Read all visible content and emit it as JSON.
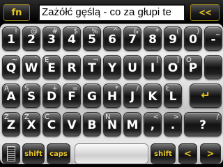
{
  "top_bar": {
    "fn_label": "fn",
    "text_value": "Zażółć gęślą - co za głupi te",
    "backspace_label": "<<"
  },
  "rows": [
    [
      {
        "main": "1",
        "alt": "!"
      },
      {
        "main": "2",
        "alt": "@"
      },
      {
        "main": "3",
        "alt": "#"
      },
      {
        "main": "4",
        "alt": "$"
      },
      {
        "main": "5",
        "alt": "%"
      },
      {
        "main": "6",
        "alt": "^"
      },
      {
        "main": "7",
        "alt": "&"
      },
      {
        "main": "8",
        "alt": "*"
      },
      {
        "main": "9",
        "alt": "("
      },
      {
        "main": "0",
        "alt": ")"
      },
      {
        "main": "-",
        "alt": "_"
      }
    ],
    [
      {
        "main": "Q",
        "alt": "~",
        "alt_left": ""
      },
      {
        "main": "W",
        "alt": "`",
        "alt_left": ""
      },
      {
        "main": "E",
        "alt": "",
        "alt_left": "Ę"
      },
      {
        "main": "R",
        "alt": "",
        "alt_left": ""
      },
      {
        "main": "T",
        "alt": "¬",
        "alt_left": ""
      },
      {
        "main": "Y",
        "alt": "",
        "alt_left": ""
      },
      {
        "main": "U",
        "alt": "",
        "alt_left": ""
      },
      {
        "main": "I",
        "alt": "[",
        "alt_left": ""
      },
      {
        "main": "O",
        "alt": "]",
        "alt_left": ""
      },
      {
        "main": "P",
        "alt": "",
        "alt_left": "Ó"
      },
      {
        "main": "",
        "alt": "",
        "alt_left": ""
      }
    ],
    [
      {
        "main": "A",
        "alt": "",
        "alt_left": "Ą"
      },
      {
        "main": "S",
        "alt": "",
        "alt_left": "Ś"
      },
      {
        "main": "D",
        "alt": "+",
        "alt_left": ""
      },
      {
        "main": "F",
        "alt": "=",
        "alt_left": ""
      },
      {
        "main": "G",
        "alt": "",
        "alt_left": ""
      },
      {
        "main": "H",
        "alt": "*",
        "alt_left": ""
      },
      {
        "main": "J",
        "alt": "/",
        "alt_left": ""
      },
      {
        "main": "K",
        "alt": "",
        "alt_left": ""
      },
      {
        "main": "L",
        "alt": "",
        "alt_left": "Ł"
      },
      {
        "main": "",
        "alt": "",
        "alt_left": ""
      }
    ],
    [
      {
        "main": "Z",
        "alt": "",
        "alt_left": "Ż"
      },
      {
        "main": "X",
        "alt": "",
        "alt_left": "Ź"
      },
      {
        "main": "C",
        "alt": "",
        "alt_left": "Ć"
      },
      {
        "main": "V",
        "alt": "",
        "alt_left": ""
      },
      {
        "main": "B",
        "alt": "",
        "alt_left": ""
      },
      {
        "main": "N",
        "alt": "",
        "alt_left": "Ń"
      },
      {
        "main": "M",
        "alt": "",
        "alt_left": ""
      },
      {
        "main": ",",
        "alt": "<",
        "alt_left": ""
      },
      {
        "main": ".",
        "alt": ">",
        "alt_left": ""
      },
      {
        "main": "?",
        "alt": "/",
        "alt_left": ""
      }
    ]
  ],
  "bottom": {
    "shift_left": "shift",
    "caps": "caps",
    "shift_right": "shift",
    "left_arrow": "<",
    "right_arrow": ">"
  },
  "accent_color": "#e9c526"
}
